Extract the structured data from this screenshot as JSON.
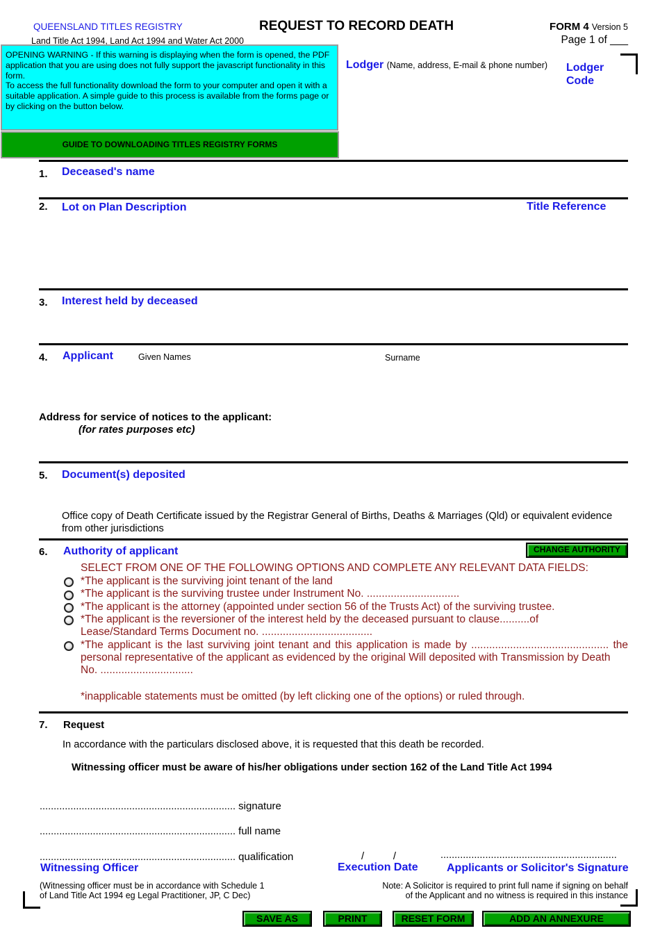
{
  "header": {
    "registry": "QUEENSLAND TITLES REGISTRY",
    "acts": "Land Title Act 1994, Land Act 1994 and Water Act 2000",
    "title": "REQUEST TO RECORD DEATH",
    "form_number": "FORM 4",
    "version": "Version 5",
    "page": "Page 1 of ___"
  },
  "warning": {
    "line1": "OPENING WARNING - If this warning is displaying when the form is opened, the PDF application that you are using does not fully support the javascript functionality in this form.",
    "line2": "To access the full functionality download the form to your computer and open it with a suitable application. A simple guide to this process is available from the forms page or by clicking on the button below.",
    "guide_button": "GUIDE TO DOWNLOADING TITLES REGISTRY FORMS",
    "bg_color": "#00ffff",
    "button_color": "#00a000"
  },
  "lodger": {
    "label": "Lodger",
    "hint": "(Name, address, E-mail & phone number)",
    "code_label_1": "Lodger",
    "code_label_2": "Code"
  },
  "sections": {
    "s1": {
      "num": "1.",
      "label": "Deceased's name"
    },
    "s2": {
      "num": "2.",
      "label": "Lot on Plan Description",
      "label_right": "Title Reference"
    },
    "s3": {
      "num": "3.",
      "label": "Interest held by deceased"
    },
    "s4": {
      "num": "4.",
      "label": "Applicant",
      "given_names": "Given Names",
      "surname": "Surname",
      "address_label": "Address for service of notices to the applicant:",
      "address_hint": "(for rates purposes etc)"
    },
    "s5": {
      "num": "5.",
      "label": "Document(s) deposited",
      "text": "Office copy of Death Certificate issued by the Registrar General of Births, Deaths & Marriages (Qld) or equivalent evidence from other jurisdictions"
    },
    "s6": {
      "num": "6.",
      "label": "Authority of applicant",
      "change_button": "CHANGE AUTHORITY",
      "instruction": "SELECT FROM ONE OF THE FOLLOWING OPTIONS AND COMPLETE ANY RELEVANT DATA FIELDS:",
      "options": [
        {
          "line1": "*The applicant is the surviving joint tenant of the land"
        },
        {
          "line1": "*The applicant is the surviving trustee under Instrument No. ..............................."
        },
        {
          "line1": "*The applicant is the attorney (appointed under section 56 of the Trusts Act) of the surviving trustee."
        },
        {
          "line1": "*The applicant is the reversioner of the interest held by the deceased pursuant to clause..........of",
          "line2": "Lease/Standard Terms Document no. ....................................."
        },
        {
          "line1": "*The applicant is the last surviving joint tenant and this application is made by .............................................. the",
          "line2": "personal representative of the applicant as evidenced by the original Will deposited with Transmission by Death",
          "line3": "No. ..............................."
        }
      ],
      "note": "*inapplicable statements must be omitted (by left clicking one of the options) or ruled through."
    },
    "s7": {
      "num": "7.",
      "label": "Request",
      "text": "In accordance with the particulars disclosed above, it is requested that this death be recorded.",
      "witness_notice": "Witnessing officer must be aware of his/her obligations under section 162 of the Land Title Act 1994"
    }
  },
  "signature": {
    "dots": "......................................................................",
    "signature": "signature",
    "full_name": "full name",
    "qualification": "qualification",
    "witnessing_officer": "Witnessing Officer",
    "witness_note_1": "(Witnessing officer must be in accordance with Schedule 1",
    "witness_note_2": "of Land Title Act 1994 eg Legal Practitioner, JP, C Dec)",
    "date_slashes": "/          /",
    "execution_date": "Execution Date",
    "applicant_dots": "...............................................................",
    "applicant_signature": "Applicants or Solicitor's Signature",
    "solicitor_note_1": "Note: A Solicitor is required to print full name if signing on behalf",
    "solicitor_note_2": "of the Applicant and no witness is required in this instance"
  },
  "buttons": {
    "save_as": "SAVE AS",
    "print": "PRINT",
    "reset": "RESET FORM",
    "annexure": "ADD AN ANNEXURE"
  }
}
